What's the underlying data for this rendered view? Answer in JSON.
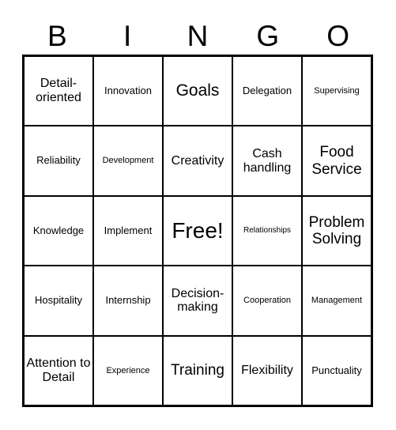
{
  "card": {
    "title_letters": [
      "B",
      "I",
      "N",
      "G",
      "O"
    ],
    "free_space_label": "Free!",
    "grid": {
      "rows": 5,
      "columns": 5,
      "cells": [
        [
          {
            "label": "Detail-oriented",
            "size": "l"
          },
          {
            "label": "Innovation",
            "size": "m"
          },
          {
            "label": "Goals",
            "size": "xxl"
          },
          {
            "label": "Delegation",
            "size": "m"
          },
          {
            "label": "Supervising",
            "size": "s"
          }
        ],
        [
          {
            "label": "Reliability",
            "size": "m"
          },
          {
            "label": "Development",
            "size": "s"
          },
          {
            "label": "Creativity",
            "size": "l"
          },
          {
            "label": "Cash handling",
            "size": "l"
          },
          {
            "label": "Food Service",
            "size": "xl"
          }
        ],
        [
          {
            "label": "Knowledge",
            "size": "m"
          },
          {
            "label": "Implement",
            "size": "m"
          },
          {
            "label": "Free!",
            "size": "free"
          },
          {
            "label": "Relationships",
            "size": "xs"
          },
          {
            "label": "Problem Solving",
            "size": "xl"
          }
        ],
        [
          {
            "label": "Hospitality",
            "size": "m"
          },
          {
            "label": "Internship",
            "size": "m"
          },
          {
            "label": "Decision-making",
            "size": "l"
          },
          {
            "label": "Cooperation",
            "size": "s"
          },
          {
            "label": "Management",
            "size": "s"
          }
        ],
        [
          {
            "label": "Attention to Detail",
            "size": "l"
          },
          {
            "label": "Experience",
            "size": "s"
          },
          {
            "label": "Training",
            "size": "xl"
          },
          {
            "label": "Flexibility",
            "size": "l"
          },
          {
            "label": "Punctuality",
            "size": "m"
          }
        ]
      ]
    },
    "colors": {
      "background": "#ffffff",
      "text": "#000000",
      "border": "#000000"
    }
  }
}
